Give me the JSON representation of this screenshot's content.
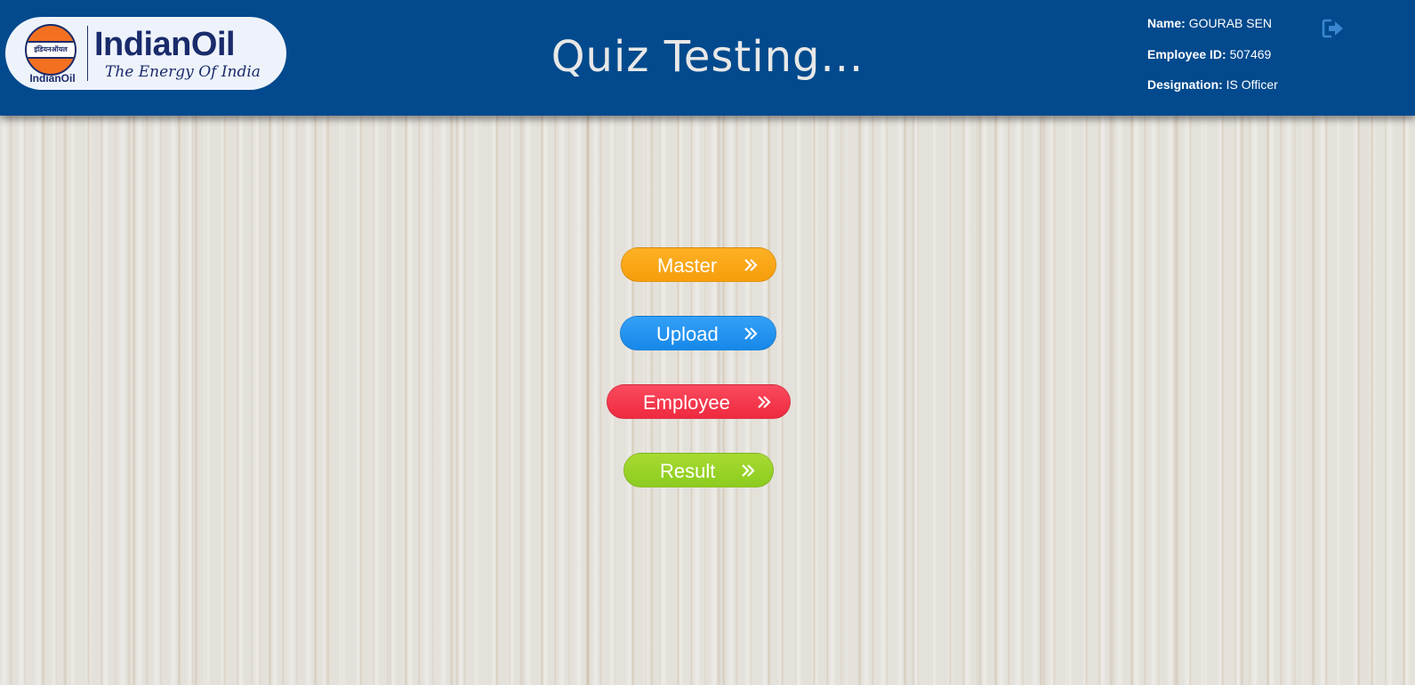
{
  "header": {
    "logo": {
      "emblem_text": "इंडियनऑयल",
      "caption": "IndianOil",
      "brand": "IndianOil",
      "tagline": "The Energy Of India"
    },
    "title": "Quiz Testing...",
    "background_color": "#024a8d",
    "user": {
      "name_label": "Name:",
      "name_value": "GOURAB SEN",
      "id_label": "Employee ID:",
      "id_value": "507469",
      "designation_label": "Designation:",
      "designation_value": "IS Officer"
    },
    "logout_icon": "sign-out-icon"
  },
  "menu": [
    {
      "label": "Master",
      "color": "#f9a518",
      "icon": "double-chevron-right-icon"
    },
    {
      "label": "Upload",
      "color": "#2196f3",
      "icon": "double-chevron-right-icon"
    },
    {
      "label": "Employee",
      "color": "#f33a4f",
      "icon": "double-chevron-right-icon"
    },
    {
      "label": "Result",
      "color": "#9ad32a",
      "icon": "double-chevron-right-icon"
    }
  ]
}
